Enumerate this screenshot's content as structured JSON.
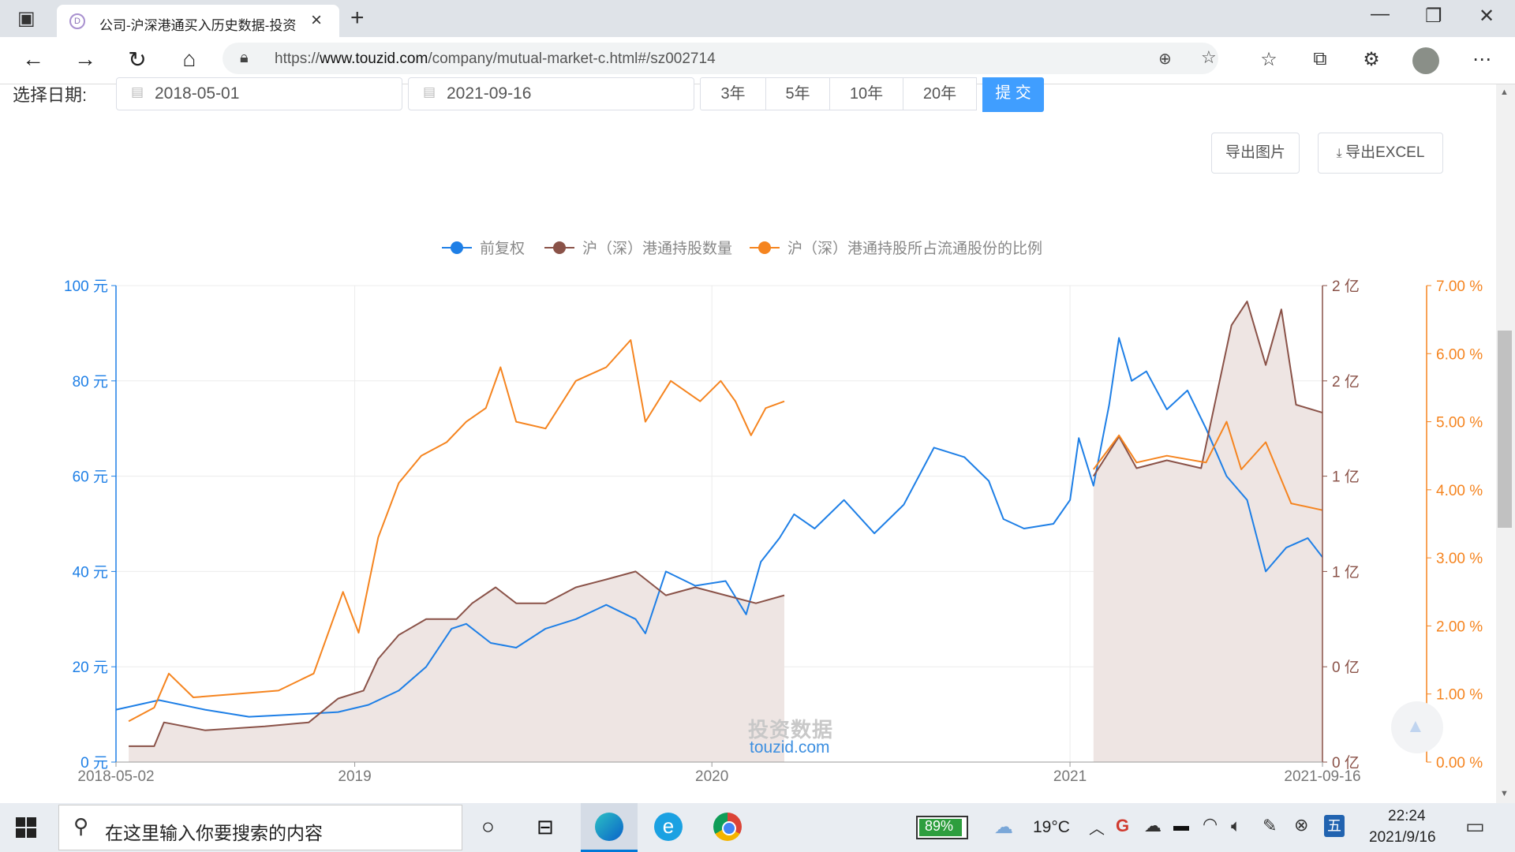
{
  "browser": {
    "tab_title": "公司-沪深港通买入历史数据-投资",
    "url_prefix": "https://",
    "url_domain": "www.touzid.com",
    "url_path": "/company/mutual-market-c.html#/sz002714"
  },
  "filters": {
    "date_label": "选择日期:",
    "start_date": "2018-05-01",
    "end_date": "2021-09-16",
    "ranges": [
      "3年",
      "5年",
      "10年",
      "20年"
    ],
    "submit": "提 交",
    "export_image": "导出图片",
    "export_excel": "导出EXCEL"
  },
  "watermark": {
    "line1": "投资数据",
    "line2": "touzid.com"
  },
  "taskbar": {
    "search_placeholder": "在这里输入你要搜索的内容",
    "battery": "89%",
    "weather": "19°C",
    "ime": "五",
    "time": "22:24",
    "date": "2021/9/16"
  },
  "chart_data": {
    "type": "line",
    "legend": [
      "前复权",
      "沪（深）港通持股数量",
      "沪（深）港通持股所占流通股份的比例"
    ],
    "legend_position": "top-center",
    "colors": {
      "price": "#1e7fe6",
      "holdings": "#8a5248",
      "ratio": "#f5841f",
      "holdings_fill": "#eee5e3"
    },
    "x_ticks": [
      "2018-05-02",
      "2019",
      "2020",
      "2021",
      "2021-09-16"
    ],
    "x_range": [
      "2018-05-02",
      "2021-09-16"
    ],
    "y_left": {
      "ticks": [
        "0 元",
        "20 元",
        "40 元",
        "60 元",
        "80 元",
        "100 元"
      ],
      "range": [
        0,
        100
      ],
      "unit": "元"
    },
    "y_right1": {
      "ticks": [
        "0 亿",
        "0 亿",
        "1 亿",
        "1 亿",
        "2 亿",
        "2 亿"
      ],
      "range": [
        0,
        0.6
      ],
      "unit": "亿"
    },
    "y_right2": {
      "ticks": [
        "0.00 %",
        "1.00 %",
        "2.00 %",
        "3.00 %",
        "4.00 %",
        "5.00 %",
        "6.00 %",
        "7.00 %"
      ],
      "range": [
        0,
        7
      ],
      "unit": "%"
    },
    "grid": true,
    "series": [
      {
        "name": "前复权",
        "axis": "left",
        "points": [
          [
            "2018-05-02",
            11
          ],
          [
            "2018-06-15",
            13
          ],
          [
            "2018-08-01",
            11
          ],
          [
            "2018-09-15",
            9.5
          ],
          [
            "2018-11-01",
            10
          ],
          [
            "2018-12-15",
            10.5
          ],
          [
            "2019-01-15",
            12
          ],
          [
            "2019-02-15",
            15
          ],
          [
            "2019-03-15",
            20
          ],
          [
            "2019-04-10",
            28
          ],
          [
            "2019-04-25",
            29
          ],
          [
            "2019-05-20",
            25
          ],
          [
            "2019-06-15",
            24
          ],
          [
            "2019-07-15",
            28
          ],
          [
            "2019-08-15",
            30
          ],
          [
            "2019-09-15",
            33
          ],
          [
            "2019-10-15",
            30
          ],
          [
            "2019-10-25",
            27
          ],
          [
            "2019-11-15",
            40
          ],
          [
            "2019-12-15",
            37
          ],
          [
            "2020-01-15",
            38
          ],
          [
            "2020-02-05",
            31
          ],
          [
            "2020-02-20",
            42
          ],
          [
            "2020-03-10",
            47
          ],
          [
            "2020-03-25",
            52
          ],
          [
            "2020-04-15",
            49
          ],
          [
            "2020-05-15",
            55
          ],
          [
            "2020-06-15",
            48
          ],
          [
            "2020-07-15",
            54
          ],
          [
            "2020-08-15",
            66
          ],
          [
            "2020-09-15",
            64
          ],
          [
            "2020-10-10",
            59
          ],
          [
            "2020-10-25",
            51
          ],
          [
            "2020-11-15",
            49
          ],
          [
            "2020-12-15",
            50
          ],
          [
            "2021-01-01",
            55
          ],
          [
            "2021-01-10",
            68
          ],
          [
            "2021-01-25",
            58
          ],
          [
            "2021-02-10",
            75
          ],
          [
            "2021-02-20",
            89
          ],
          [
            "2021-03-05",
            80
          ],
          [
            "2021-03-20",
            82
          ],
          [
            "2021-04-10",
            74
          ],
          [
            "2021-05-01",
            78
          ],
          [
            "2021-05-20",
            70
          ],
          [
            "2021-06-10",
            60
          ],
          [
            "2021-07-01",
            55
          ],
          [
            "2021-07-20",
            40
          ],
          [
            "2021-08-10",
            45
          ],
          [
            "2021-09-01",
            47
          ],
          [
            "2021-09-16",
            43
          ]
        ]
      },
      {
        "name": "沪（深）港通持股数量",
        "axis": "right1",
        "points": [
          [
            "2018-05-15",
            0.02
          ],
          [
            "2018-06-10",
            0.02
          ],
          [
            "2018-06-20",
            0.05
          ],
          [
            "2018-08-01",
            0.04
          ],
          [
            "2018-10-01",
            0.045
          ],
          [
            "2018-11-15",
            0.05
          ],
          [
            "2018-12-15",
            0.08
          ],
          [
            "2019-01-10",
            0.09
          ],
          [
            "2019-01-25",
            0.13
          ],
          [
            "2019-02-15",
            0.16
          ],
          [
            "2019-03-15",
            0.18
          ],
          [
            "2019-04-15",
            0.18
          ],
          [
            "2019-05-01",
            0.2
          ],
          [
            "2019-05-25",
            0.22
          ],
          [
            "2019-06-15",
            0.2
          ],
          [
            "2019-07-15",
            0.2
          ],
          [
            "2019-08-15",
            0.22
          ],
          [
            "2019-09-15",
            0.23
          ],
          [
            "2019-10-15",
            0.24
          ],
          [
            "2019-11-15",
            0.21
          ],
          [
            "2019-12-15",
            0.22
          ],
          [
            "2020-01-15",
            0.21
          ],
          [
            "2020-02-15",
            0.2
          ],
          [
            "2020-03-15",
            0.21
          ],
          [
            "2021-01-25",
            0.36
          ],
          [
            "2021-02-20",
            0.41
          ],
          [
            "2021-03-10",
            0.37
          ],
          [
            "2021-04-10",
            0.38
          ],
          [
            "2021-05-15",
            0.37
          ],
          [
            "2021-06-15",
            0.55
          ],
          [
            "2021-07-01",
            0.58
          ],
          [
            "2021-07-20",
            0.5
          ],
          [
            "2021-08-05",
            0.57
          ],
          [
            "2021-08-20",
            0.45
          ],
          [
            "2021-09-16",
            0.44
          ]
        ]
      },
      {
        "name": "沪（深）港通持股所占流通股份的比例",
        "axis": "right2",
        "points": [
          [
            "2018-05-15",
            0.6
          ],
          [
            "2018-06-10",
            0.8
          ],
          [
            "2018-06-25",
            1.3
          ],
          [
            "2018-07-20",
            0.95
          ],
          [
            "2018-09-01",
            1.0
          ],
          [
            "2018-10-15",
            1.05
          ],
          [
            "2018-11-20",
            1.3
          ],
          [
            "2018-12-20",
            2.5
          ],
          [
            "2019-01-05",
            1.9
          ],
          [
            "2019-01-25",
            3.3
          ],
          [
            "2019-02-15",
            4.1
          ],
          [
            "2019-03-10",
            4.5
          ],
          [
            "2019-04-05",
            4.7
          ],
          [
            "2019-04-25",
            5.0
          ],
          [
            "2019-05-15",
            5.2
          ],
          [
            "2019-05-30",
            5.8
          ],
          [
            "2019-06-15",
            5.0
          ],
          [
            "2019-07-15",
            4.9
          ],
          [
            "2019-08-15",
            5.6
          ],
          [
            "2019-09-15",
            5.8
          ],
          [
            "2019-10-10",
            6.2
          ],
          [
            "2019-10-25",
            5.0
          ],
          [
            "2019-11-20",
            5.6
          ],
          [
            "2019-12-20",
            5.3
          ],
          [
            "2020-01-10",
            5.6
          ],
          [
            "2020-01-25",
            5.3
          ],
          [
            "2020-02-10",
            4.8
          ],
          [
            "2020-02-25",
            5.2
          ],
          [
            "2020-03-15",
            5.3
          ],
          [
            "2021-01-25",
            4.3
          ],
          [
            "2021-02-20",
            4.8
          ],
          [
            "2021-03-10",
            4.4
          ],
          [
            "2021-04-10",
            4.5
          ],
          [
            "2021-05-20",
            4.4
          ],
          [
            "2021-06-10",
            5.0
          ],
          [
            "2021-06-25",
            4.3
          ],
          [
            "2021-07-20",
            4.7
          ],
          [
            "2021-08-15",
            3.8
          ],
          [
            "2021-09-16",
            3.7
          ]
        ]
      }
    ]
  }
}
